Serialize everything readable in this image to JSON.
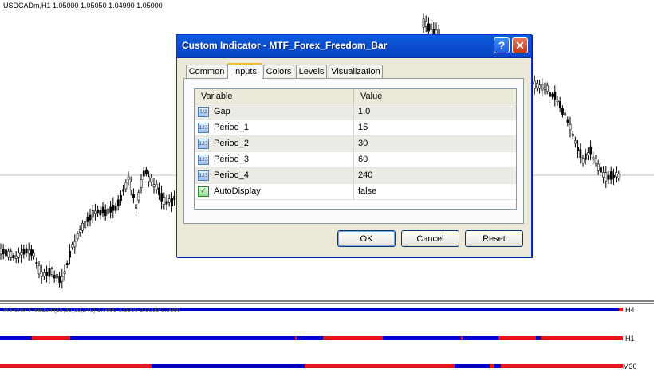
{
  "chart": {
    "title": "USDCADm,H1  1.05000 1.05050 1.04990 1.05000",
    "subwindow_label": "M Forex Freedom(15,30,60,240) 1.0000 3.0000 2.0000 1.0000",
    "bar_labels": [
      "H4",
      "H1",
      "M30"
    ],
    "colors": {
      "up": "#0000cc",
      "down": "#e8141c",
      "candle": "#000000",
      "grid": "#c0c0c0"
    }
  },
  "dialog": {
    "title": "Custom Indicator - MTF_Forex_Freedom_Bar",
    "help_label": "?",
    "close_label": "✕",
    "tabs": [
      {
        "label": "Common"
      },
      {
        "label": "Inputs"
      },
      {
        "label": "Colors"
      },
      {
        "label": "Levels"
      },
      {
        "label": "Visualization"
      }
    ],
    "active_tab": "Inputs",
    "grid": {
      "headers": {
        "variable": "Variable",
        "value": "Value"
      },
      "rows": [
        {
          "icon": "1/2",
          "name": "Gap",
          "value": "1.0"
        },
        {
          "icon": "123",
          "name": "Period_1",
          "value": "15"
        },
        {
          "icon": "123",
          "name": "Period_2",
          "value": "30"
        },
        {
          "icon": "123",
          "name": "Period_3",
          "value": "60"
        },
        {
          "icon": "123",
          "name": "Period_4",
          "value": "240"
        },
        {
          "icon": "✓",
          "name": "AutoDisplay",
          "value": "false"
        }
      ]
    },
    "buttons": {
      "ok": "OK",
      "cancel": "Cancel",
      "reset": "Reset"
    }
  }
}
